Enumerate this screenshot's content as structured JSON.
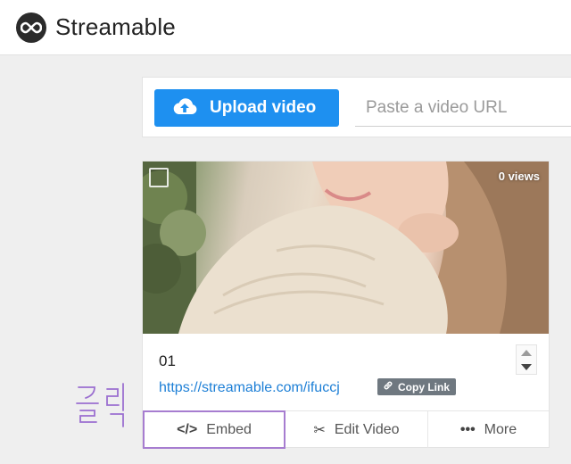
{
  "header": {
    "brand": "Streamable"
  },
  "upload": {
    "button_label": "Upload video",
    "url_placeholder": "Paste a video URL"
  },
  "video": {
    "views": "0 views",
    "title": "01",
    "url": "https://streamable.com/ifuccj",
    "copy_link_label": "Copy Link"
  },
  "actions": {
    "embed_label": "Embed",
    "edit_label": "Edit Video",
    "more_label": "More"
  },
  "annotation": {
    "text": "클릭"
  },
  "colors": {
    "accent": "#1e90f0",
    "link": "#1d7fd6",
    "highlight": "#a77dd0",
    "badge": "#6f7880"
  }
}
